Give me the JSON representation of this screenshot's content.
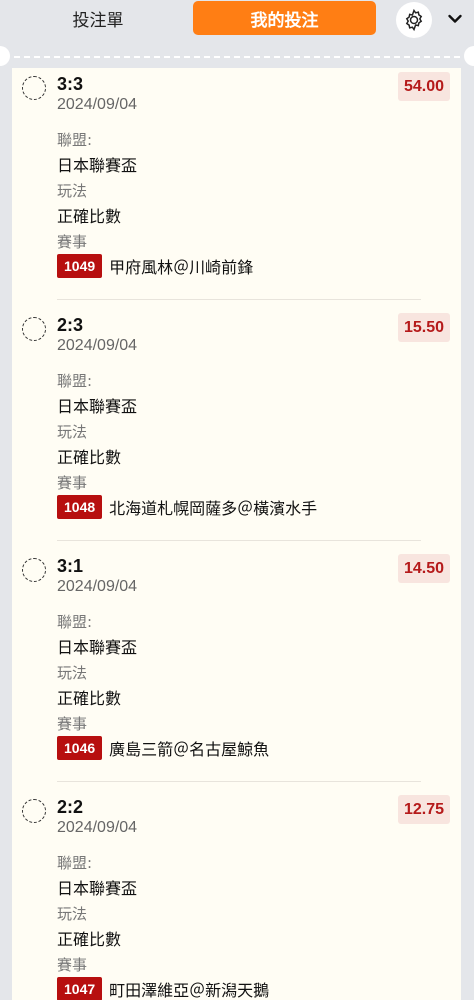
{
  "header": {
    "tabs": [
      {
        "label": "投注單",
        "active": false
      },
      {
        "label": "我的投注",
        "active": true
      }
    ],
    "settings_icon": "gear-icon",
    "collapse_icon": "chevron-down-icon"
  },
  "colors": {
    "accent": "#ff7e14",
    "odds_text": "#b51a1a",
    "odds_bg": "#f8e5df",
    "event_badge": "#b70f0f",
    "ticket_bg": "#fffdf4"
  },
  "bets": [
    {
      "score": "3:3",
      "date": "2024/09/04",
      "odds": "54.00",
      "league_label": "聯盟:",
      "league": "日本聯賽盃",
      "type_label": "玩法",
      "type": "正確比數",
      "event_label": "賽事",
      "event_id": "1049",
      "match": "甲府風林＠川崎前鋒"
    },
    {
      "score": "2:3",
      "date": "2024/09/04",
      "odds": "15.50",
      "league_label": "聯盟:",
      "league": "日本聯賽盃",
      "type_label": "玩法",
      "type": "正確比數",
      "event_label": "賽事",
      "event_id": "1048",
      "match": "北海道札幌岡薩多＠橫濱水手"
    },
    {
      "score": "3:1",
      "date": "2024/09/04",
      "odds": "14.50",
      "league_label": "聯盟:",
      "league": "日本聯賽盃",
      "type_label": "玩法",
      "type": "正確比數",
      "event_label": "賽事",
      "event_id": "1046",
      "match": "廣島三箭＠名古屋鯨魚"
    },
    {
      "score": "2:2",
      "date": "2024/09/04",
      "odds": "12.75",
      "league_label": "聯盟:",
      "league": "日本聯賽盃",
      "type_label": "玩法",
      "type": "正確比數",
      "event_label": "賽事",
      "event_id": "1047",
      "match": "町田澤維亞＠新潟天鵝"
    }
  ]
}
